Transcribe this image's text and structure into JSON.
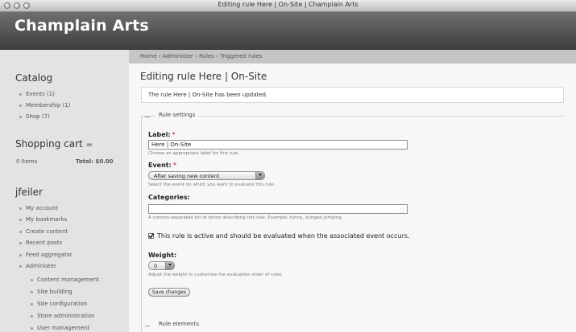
{
  "window": {
    "title": "Editing rule Here | On-Site | Champlain Arts"
  },
  "site": {
    "name": "Champlain Arts"
  },
  "sidebar": {
    "catalog": {
      "title": "Catalog",
      "items": [
        "Events (1)",
        "Membership (1)",
        "Shop (7)"
      ]
    },
    "cart": {
      "title": "Shopping cart",
      "items_label": "0 Items",
      "total_label": "Total: $0.00"
    },
    "user": {
      "title": "jfeiler",
      "items": [
        "My account",
        "My bookmarks",
        "Create content",
        "Recent posts",
        "Feed aggregator",
        "Administer"
      ],
      "admin_items": [
        "Content management",
        "Site building",
        "Site configuration",
        "Store administration",
        "User management"
      ]
    }
  },
  "breadcrumb": "Home › Administer › Rules › Triggered rules",
  "page_title": "Editing rule Here | On-Site",
  "status_message": "The rule Here | On-Site has been updated.",
  "form": {
    "fieldset_legend": "Rule settings",
    "label": {
      "label": "Label:",
      "required": "*",
      "value": "Here | On-Site",
      "description": "Choose an appropriate label for this rule."
    },
    "event": {
      "label": "Event:",
      "required": "*",
      "selected": "After saving new content",
      "description": "Select the event on which you want to evaluate this rule."
    },
    "categories": {
      "label": "Categories:",
      "value": "",
      "description": "A comma-separated list of terms describing this rule. Example: funny, bungee jumping."
    },
    "active": {
      "label": "This rule is active and should be evaluated when the associated event occurs.",
      "checked": true
    },
    "weight": {
      "label": "Weight:",
      "selected": "0",
      "description": "Adjust the weight to customize the evaluation order of rules."
    },
    "save_button": "Save changes",
    "next_section": "Rule elements"
  }
}
